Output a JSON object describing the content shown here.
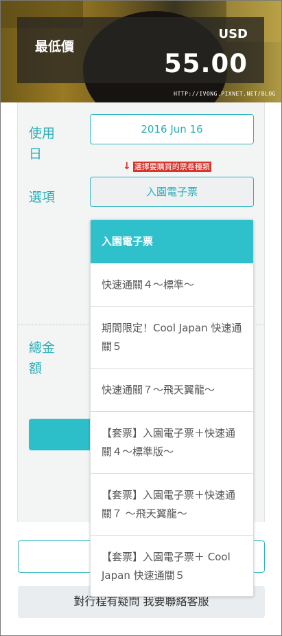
{
  "header": {
    "price_label": "最低價",
    "currency": "USD",
    "amount": "55.00",
    "watermark": "HTTP://IVONG.PIXNET.NET/BLOG"
  },
  "form": {
    "date_label": "使用日",
    "date_value": "2016 Jun 16",
    "hint_text": "選擇要購買的票卷種類",
    "option_label": "選項",
    "option_value": "入園電子票",
    "total_label": "總金額"
  },
  "dropdown": {
    "items": [
      "入園電子票",
      "快速通關４～標準～",
      "期間限定！Cool Japan 快速通關５",
      "快速通關７～飛天翼龍～",
      "【套票】入園電子票＋快速通關４～標準版～",
      "【套票】入園電子票＋快速通關７ ～飛天翼龍～",
      "【套票】入園電子票＋ Cool Japan 快速通關５"
    ],
    "selected_index": 0
  },
  "footer": {
    "contact_label": "對行程有疑問 我要聯絡客服"
  },
  "colors": {
    "accent": "#2ec0cb",
    "hint": "#d8342c"
  }
}
